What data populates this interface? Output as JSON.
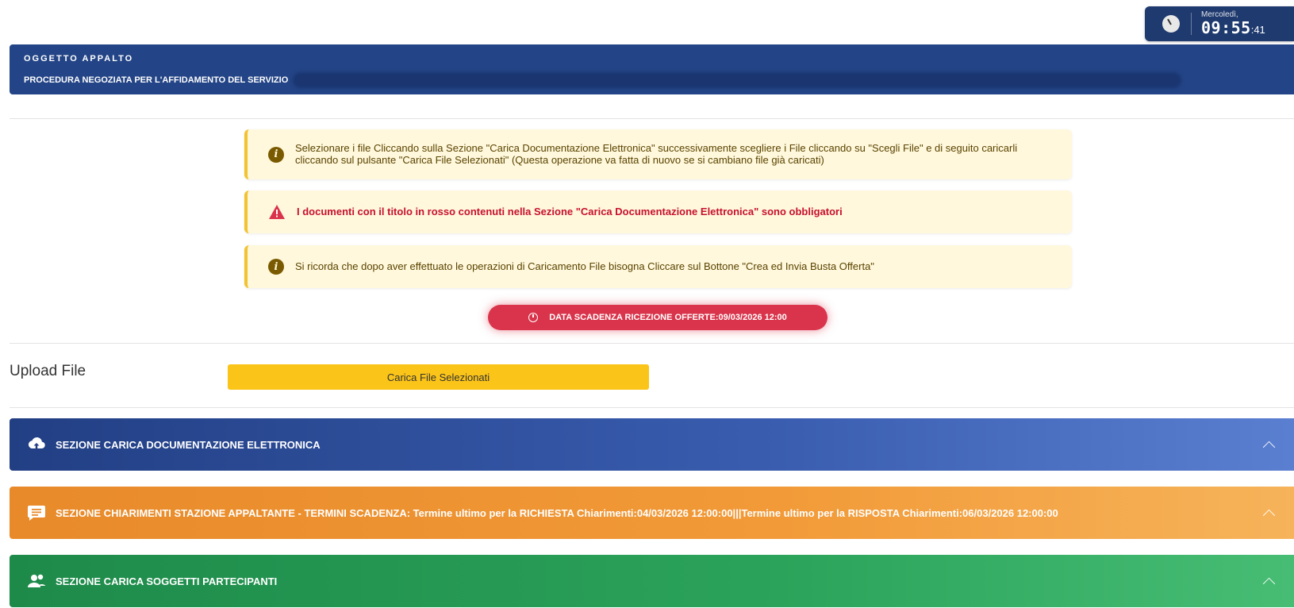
{
  "clock": {
    "day": "Mercoledì,",
    "time": "09:55",
    "seconds": ":41"
  },
  "oggetto": {
    "label": "OGGETTO APPALTO",
    "text": "PROCEDURA NEGOZIATA PER L'AFFIDAMENTO DEL SERVIZIO"
  },
  "alerts": [
    {
      "type": "info",
      "icon": "info-icon",
      "text": "Selezionare i file Cliccando sulla Sezione \"Carica Documentazione Elettronica\" successivamente scegliere i File cliccando su \"Scegli File\" e di seguito caricarli cliccando sul pulsante \"Carica File Selezionati\" (Questa operazione va fatta di nuovo se si cambiano file già caricati)"
    },
    {
      "type": "danger",
      "icon": "warning-icon",
      "text": "I documenti con il titolo in rosso contenuti nella Sezione \"Carica Documentazione Elettronica\" sono obbligatori"
    },
    {
      "type": "info",
      "icon": "info-icon",
      "text": "Si ricorda che dopo aver effettuato le operazioni di Caricamento File bisogna Cliccare sul Bottone \"Crea ed Invia Busta Offerta\""
    }
  ],
  "deadline": {
    "text": "DATA SCADENZA RICEZIONE OFFERTE:09/03/2026 12:00"
  },
  "upload": {
    "label": "Upload File",
    "button": "Carica File Selezionati"
  },
  "panels": [
    {
      "title": "SEZIONE CARICA DOCUMENTAZIONE ELETTRONICA",
      "icon": "cloud-upload-icon",
      "color": "#223f84"
    },
    {
      "title": "SEZIONE CHIARIMENTI STAZIONE APPALTANTE - TERMINI SCADENZA: Termine ultimo per la RICHIESTA Chiarimenti:04/03/2026 12:00:00|||Termine ultimo per la RISPOSTA Chiarimenti:06/03/2026 12:00:00",
      "icon": "chat-icon",
      "color": "#e88a2a"
    },
    {
      "title": "SEZIONE CARICA SOGGETTI PARTECIPANTI",
      "icon": "users-icon",
      "color": "#1e8a4a"
    }
  ]
}
